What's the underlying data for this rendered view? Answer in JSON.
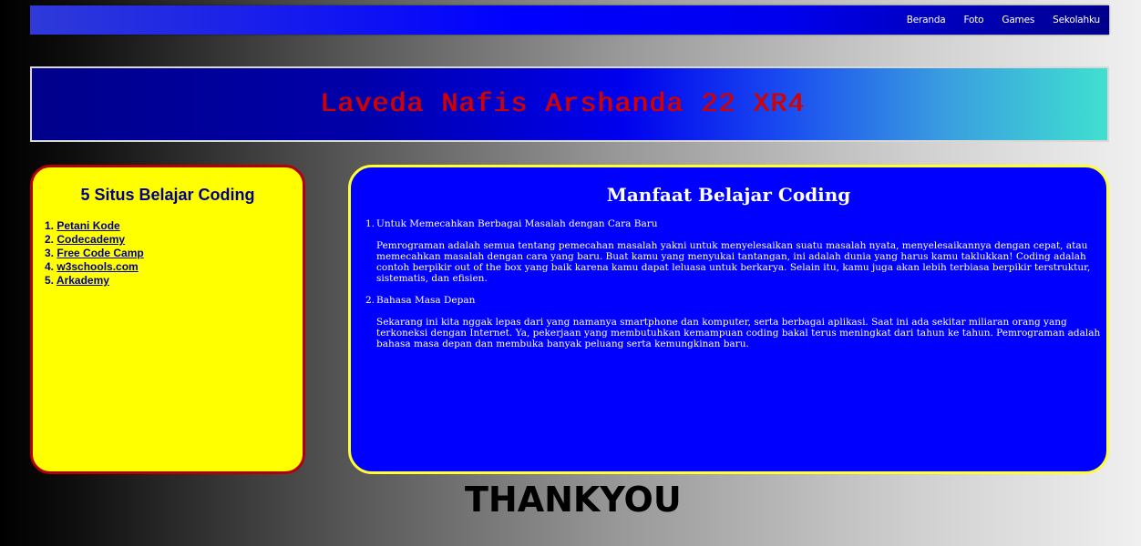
{
  "nav": {
    "items": [
      "Beranda",
      "Foto",
      "Games",
      "Sekolahku"
    ]
  },
  "banner": {
    "title": "Laveda Nafis Arshanda 22 XR4"
  },
  "left_panel": {
    "heading": "5 Situs Belajar Coding",
    "items": [
      {
        "num": "1.",
        "label": "Petani Kode"
      },
      {
        "num": "2.",
        "label": "Codecademy"
      },
      {
        "num": "3.",
        "label": "Free Code Camp"
      },
      {
        "num": "4.",
        "label": "w3schools.com"
      },
      {
        "num": "5.",
        "label": "Arkademy"
      }
    ]
  },
  "right_panel": {
    "heading": "Manfaat Belajar Coding",
    "items": [
      {
        "num": "1.",
        "title": "Untuk Memecahkan Berbagai Masalah dengan Cara Baru",
        "body": "Pemrograman adalah semua tentang pemecahan masalah yakni untuk menyelesaikan suatu masalah nyata, menyelesaikannya dengan cepat, atau memecahkan masalah dengan cara yang baru. Buat kamu yang menyukai tantangan, ini adalah dunia yang harus kamu taklukkan! Coding adalah contoh berpikir out of the box yang baik karena kamu dapat leluasa untuk berkarya. Selain itu, kamu juga akan lebih terbiasa berpikir terstruktur, sistematis, dan efisien."
      },
      {
        "num": "2.",
        "title": "Bahasa Masa Depan",
        "body": "Sekarang ini kita nggak lepas dari yang namanya smartphone dan komputer, serta berbagai aplikasi. Saat ini ada sekitar miliaran orang yang terkoneksi dengan Internet. Ya, pekerjaan yang membutuhkan kemampuan coding bakal terus meningkat dari tahun ke tahun. Pemrograman adalah bahasa masa depan dan membuka banyak peluang serta kemungkinan baru."
      }
    ]
  },
  "footer": {
    "text": "THANKYOU"
  },
  "colors": {
    "nav_bar": "#0000ff",
    "banner_title": "#d40000",
    "left_panel_bg": "#ffff00",
    "left_panel_border": "#b30000",
    "right_panel_bg": "#0000ff",
    "right_panel_border": "#ffff33"
  }
}
